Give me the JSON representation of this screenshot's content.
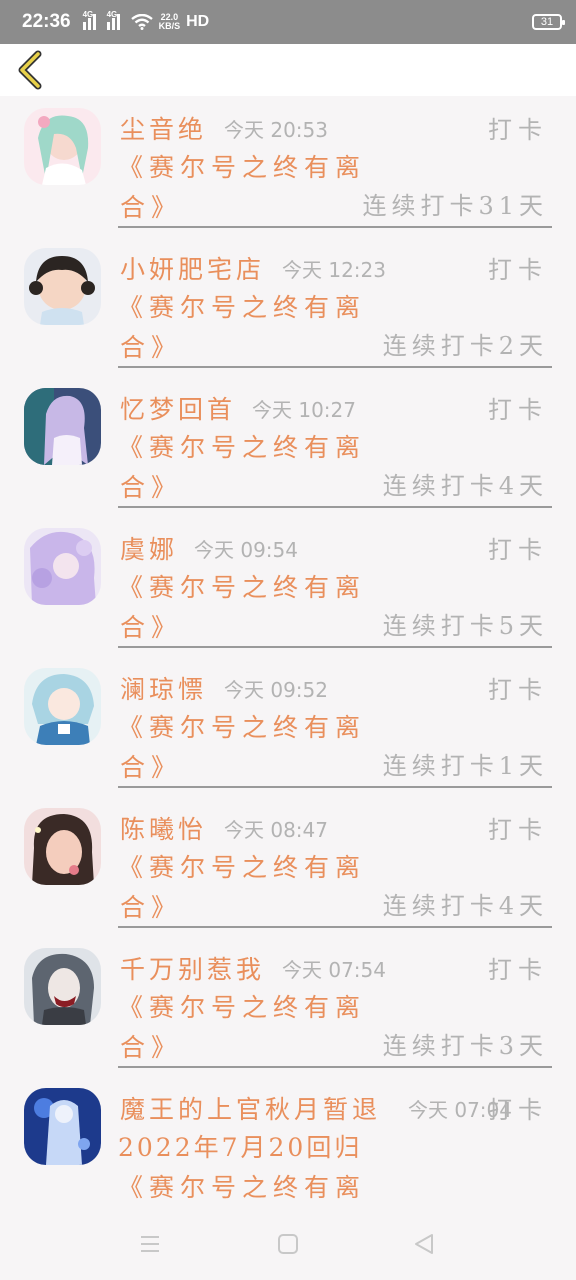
{
  "status_bar": {
    "time": "22:36",
    "signal_1_label": "4G",
    "signal_2_label": "4G",
    "net_speed_value": "22.0",
    "net_speed_unit": "KB/S",
    "hd_label": "HD",
    "battery_level": "31"
  },
  "header": {
    "back_icon": "chevron-left-icon",
    "accent_color": "#e98f5c"
  },
  "checkins": [
    {
      "name": "尘音绝",
      "time": "今天 20:53",
      "label": "打卡",
      "book_line1": "《赛尔号之终有离",
      "book_line2": "合》",
      "streak": "连续打卡31天"
    },
    {
      "name": "小妍肥宅店",
      "time": "今天 12:23",
      "label": "打卡",
      "book_line1": "《赛尔号之终有离",
      "book_line2": "合》",
      "streak": "连续打卡2天"
    },
    {
      "name": "忆梦回首",
      "time": "今天 10:27",
      "label": "打卡",
      "book_line1": "《赛尔号之终有离",
      "book_line2": "合》",
      "streak": "连续打卡4天"
    },
    {
      "name": "虞娜",
      "time": "今天 09:54",
      "label": "打卡",
      "book_line1": "《赛尔号之终有离",
      "book_line2": "合》",
      "streak": "连续打卡5天"
    },
    {
      "name": "澜琼慓",
      "time": "今天 09:52",
      "label": "打卡",
      "book_line1": "《赛尔号之终有离",
      "book_line2": "合》",
      "streak": "连续打卡1天"
    },
    {
      "name": "陈曦怡",
      "time": "今天 08:47",
      "label": "打卡",
      "book_line1": "《赛尔号之终有离",
      "book_line2": "合》",
      "streak": "连续打卡4天"
    },
    {
      "name": "千万别惹我",
      "time": "今天 07:54",
      "label": "打卡",
      "book_line1": "《赛尔号之终有离",
      "book_line2": "合》",
      "streak": "连续打卡3天"
    },
    {
      "name": "魔王的上官秋月暂退",
      "time": "今天 07:04",
      "label": "打卡",
      "date_line": "2022年7月20回归",
      "book_line1": "《赛尔号之终有离"
    }
  ],
  "nav_bar": {
    "icons": [
      "menu-icon",
      "home-square-icon",
      "back-triangle-icon"
    ]
  }
}
